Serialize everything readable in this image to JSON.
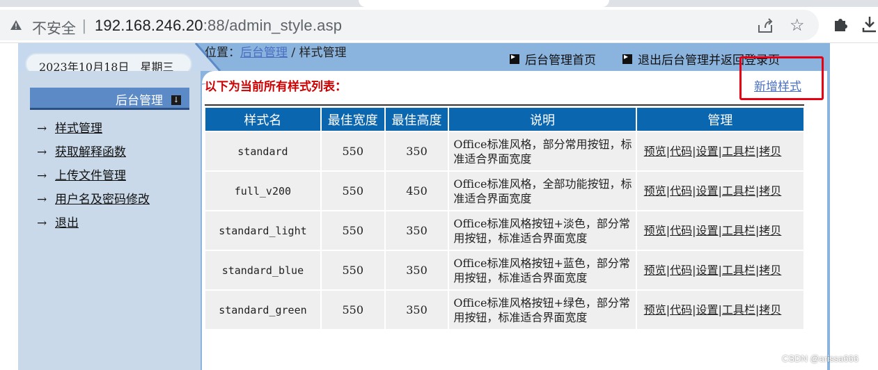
{
  "browser": {
    "security_label": "不安全",
    "divider": "|",
    "url_host": "192.168.246.20",
    "url_rest": ":88/admin_style.asp"
  },
  "header": {
    "date": "2023年10月18日　星期三",
    "nav": [
      {
        "label": "后台管理首页"
      },
      {
        "label": "退出后台管理并返回登录页"
      }
    ]
  },
  "sidebar": {
    "title": "后台管理",
    "items": [
      {
        "arrow": "→",
        "label": "样式管理"
      },
      {
        "arrow": "→",
        "label": "获取解释函数"
      },
      {
        "arrow": "→",
        "label": "上传文件管理"
      },
      {
        "arrow": "→",
        "label": "用户名及密码修改"
      },
      {
        "arrow": "→",
        "label": "退出"
      }
    ]
  },
  "main": {
    "breadcrumb_prefix": "位置：",
    "breadcrumb_link": "后台管理",
    "breadcrumb_sep": " / ",
    "breadcrumb_current": "样式管理",
    "list_title": "以下为当前所有样式列表：",
    "new_style_link": "新增样式",
    "table": {
      "headers": [
        "样式名",
        "最佳宽度",
        "最佳高度",
        "说明",
        "管理"
      ],
      "ops": [
        "预览",
        "代码",
        "设置",
        "工具栏",
        "拷贝"
      ],
      "op_sep": "|",
      "rows": [
        {
          "name": "standard",
          "width": "550",
          "height": "350",
          "desc": "Office标准风格，部分常用按钮，标准适合界面宽度"
        },
        {
          "name": "full_v200",
          "width": "550",
          "height": "450",
          "desc": "Office标准风格，全部功能按钮，标准适合界面宽度"
        },
        {
          "name": "standard_light",
          "width": "550",
          "height": "350",
          "desc": "Office标准风格按钮+淡色，部分常用按钮，标准适合界面宽度"
        },
        {
          "name": "standard_blue",
          "width": "550",
          "height": "350",
          "desc": "Office标准风格按钮+蓝色，部分常用按钮，标准适合界面宽度"
        },
        {
          "name": "standard_green",
          "width": "550",
          "height": "350",
          "desc": "Office标准风格按钮+绿色，部分常用按钮，标准适合界面宽度"
        }
      ]
    }
  },
  "watermark": "CSDN @arissa666",
  "colors": {
    "header_blue": "#8ab3de",
    "table_head": "#0b66b0",
    "highlight_red": "#e60012",
    "title_red": "#cc0000"
  }
}
